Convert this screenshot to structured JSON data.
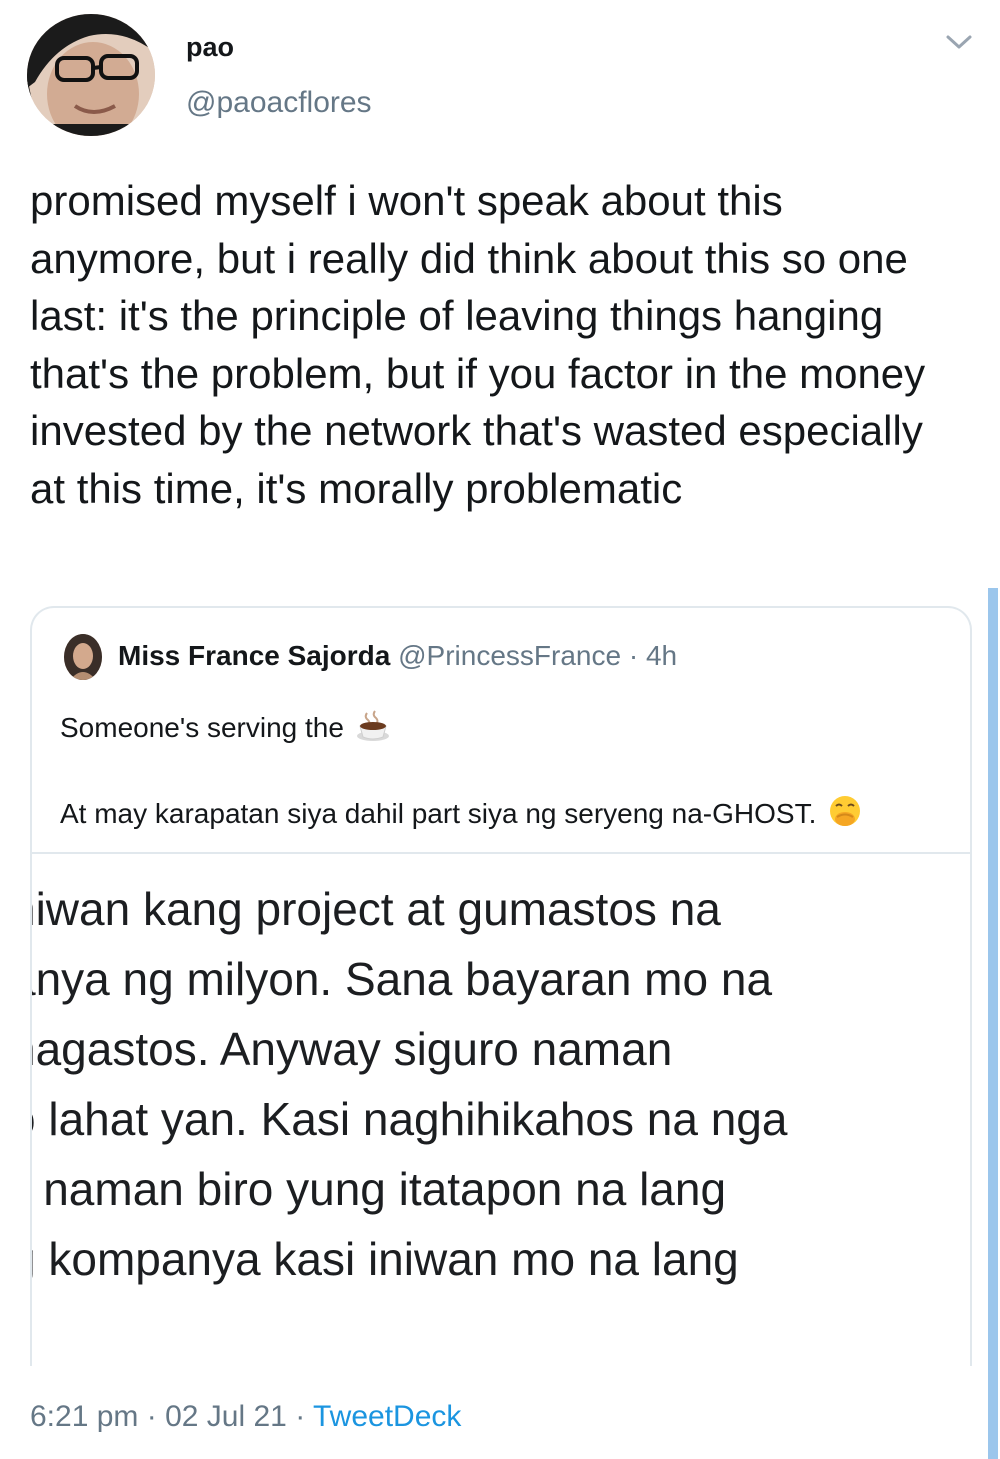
{
  "tweet": {
    "author": {
      "display_name": "pao",
      "handle": "@paoacflores"
    },
    "text": "promised myself i won't speak about this anymore, but i really did think about this so one last: it's the principle of leaving things hanging that's the problem, but if you factor in the money invested by the network that's wasted especially at this time, it's morally problematic",
    "timestamp": "6:21 pm",
    "date": "02 Jul 21",
    "separator": "·",
    "client": "TweetDeck"
  },
  "quoted_tweet": {
    "author_name": "Miss France Sajorda",
    "author_handle": "@PrincessFrance",
    "separator": "·",
    "time_ago": "4h",
    "line1": "Someone's serving the",
    "line2": "At may karapatan siya dahil part siya ng seryeng na-GHOST.",
    "media_text": [
      "niwan kang project at gumastos na",
      "anya ng milyon. Sana bayaran mo na",
      " nagastos. Anyway siguro naman",
      "o lahat yan. Kasi naghihikahos na nga",
      "li naman biro yung itatapon na lang",
      "ɡ kompanya kasi iniwan mo na lang"
    ]
  },
  "icons": {
    "menu": "chevron-down-icon",
    "tea": "hot-beverage-icon",
    "hand_over_mouth": "hand-over-mouth-emoji-icon"
  },
  "colors": {
    "text": "#14171a",
    "secondary": "#657786",
    "link": "#1b95e0",
    "border": "#e1e8ed"
  }
}
